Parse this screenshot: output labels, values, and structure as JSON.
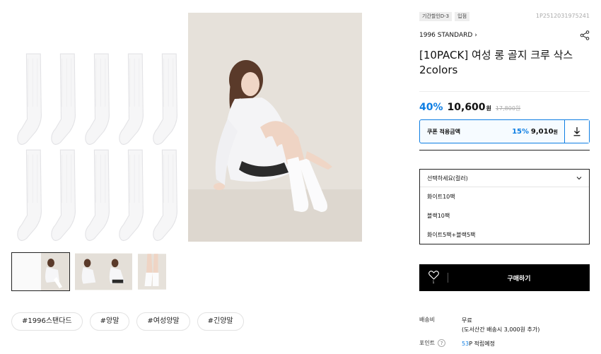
{
  "gallery": {
    "thumbnail_count": 3,
    "active_thumbnail": 1
  },
  "tags": [
    "#1996스탠다드",
    "#양말",
    "#여성양말",
    "#긴양말"
  ],
  "product": {
    "badges": [
      "기간할인D-3",
      "입점"
    ],
    "code": "1P2512031975241",
    "brand": "1996 STANDARD",
    "brand_chevron": "›",
    "title": "[10PACK] 여성 롱 골지 크루 삭스 2colors",
    "discount": "40%",
    "price": "10,600",
    "price_unit": "원",
    "original_price": "17,800원"
  },
  "coupon": {
    "label": "쿠폰 적용금액",
    "rate": "15%",
    "price": "9,010",
    "price_unit": "원"
  },
  "options": {
    "placeholder": "선택하세요(컬러)",
    "items": [
      "화이트10팩",
      "블랙10팩",
      "화이트5팩+블랙5팩"
    ]
  },
  "purchase": {
    "like_count": "1",
    "buy_label": "구매하기"
  },
  "shipping": {
    "label": "배송비",
    "value_line1": "무료",
    "value_line2": "(도서산간 배송시 3,000원 추가)"
  },
  "points": {
    "label": "포인트",
    "help": "?",
    "amount": "53",
    "suffix": "P 적립예정"
  },
  "colors": {
    "accent": "#0e7ee3",
    "buy_bar": "#000000"
  },
  "icons": [
    "share-icon",
    "chevron-right-icon",
    "download-icon",
    "chevron-down-icon",
    "heart-icon",
    "help-icon"
  ]
}
